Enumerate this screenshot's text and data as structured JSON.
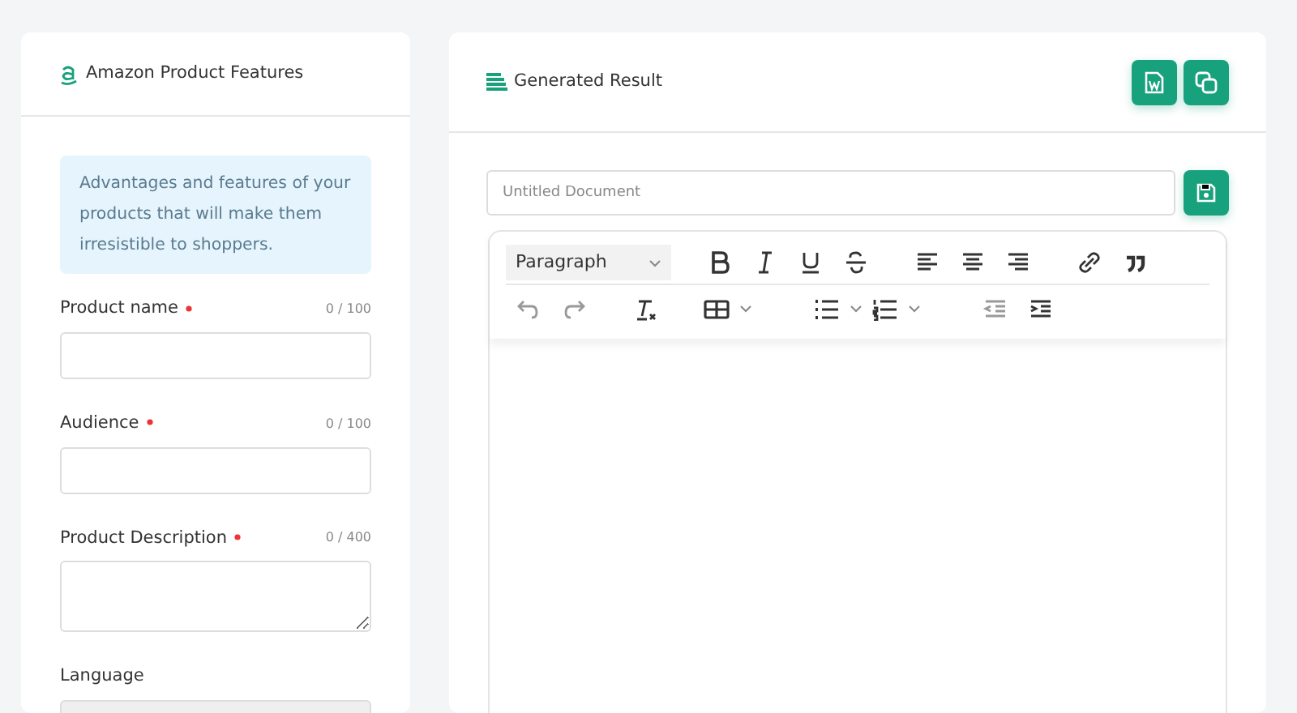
{
  "form_panel": {
    "title": "Amazon Product Features",
    "info": "Advantages and features of your products that will make them irresistible to shoppers.",
    "fields": [
      {
        "kind": "input",
        "label": "Product name",
        "required": true,
        "counter": "0 / 100"
      },
      {
        "kind": "input",
        "label": "Audience",
        "required": true,
        "counter": "0 / 100"
      },
      {
        "kind": "textarea",
        "label": "Product Description",
        "required": true,
        "counter": "0 / 400"
      },
      {
        "kind": "select",
        "label": "Language",
        "required": false
      }
    ]
  },
  "result_panel": {
    "title": "Generated Result",
    "document": {
      "placeholder": "Untitled Document"
    },
    "editor": {
      "block_format": "Paragraph"
    }
  }
}
